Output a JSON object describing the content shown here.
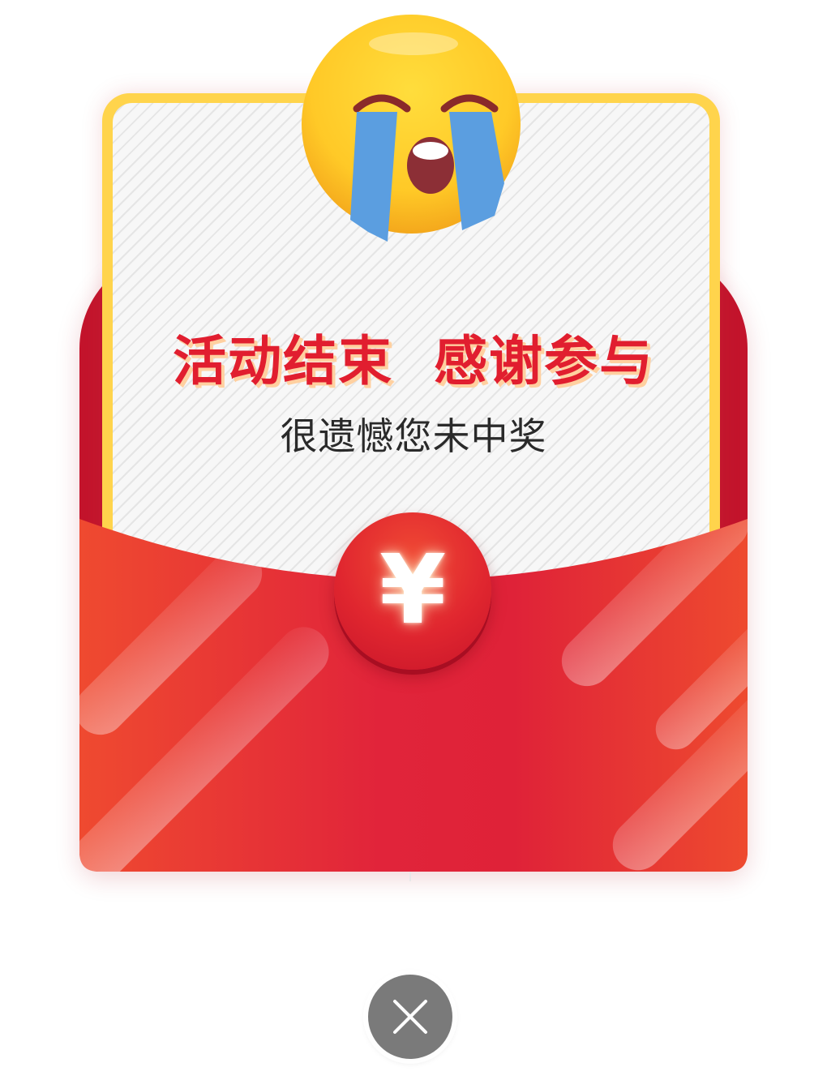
{
  "dialog": {
    "title": "活动结束  感谢参与",
    "subtitle": "很遗憾您未中奖",
    "coin_symbol": "¥",
    "emoji_icon": "crying-face-icon",
    "close_icon": "close-icon"
  },
  "colors": {
    "envelope_red": "#e22632",
    "envelope_dark_red": "#c3142c",
    "card_border_yellow": "#ffd44c",
    "title_red": "#e11e2f",
    "close_button_gray": "#7a7a7a"
  }
}
